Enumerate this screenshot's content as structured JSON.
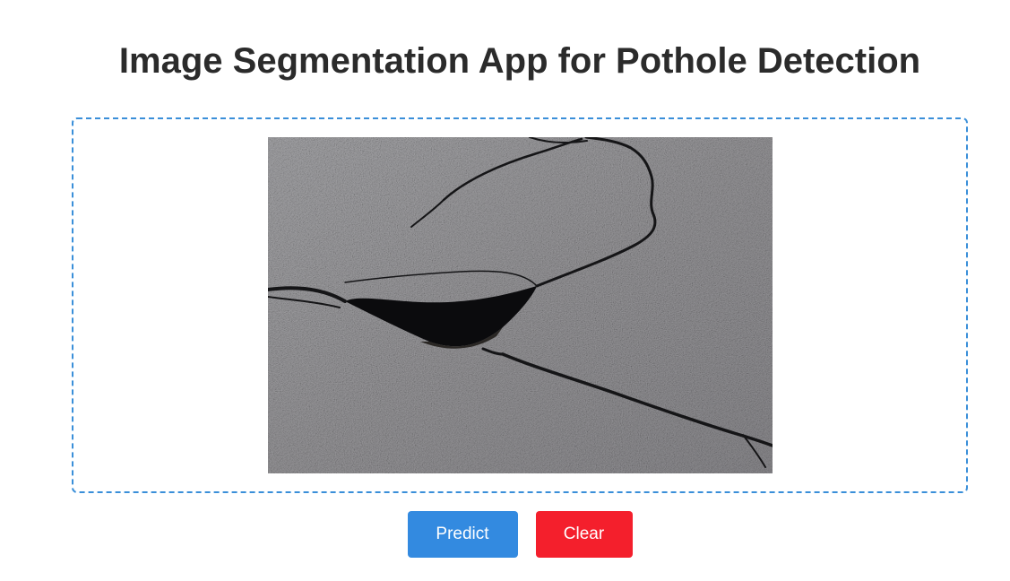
{
  "page": {
    "title": "Image Segmentation App for Pothole Detection"
  },
  "upload": {
    "image_alt": "Cracked asphalt road with a pothole"
  },
  "actions": {
    "predict_label": "Predict",
    "clear_label": "Clear"
  },
  "colors": {
    "dropzone_border": "#3a8fd9",
    "predict_button": "#338ae0",
    "clear_button": "#f41f2c"
  }
}
